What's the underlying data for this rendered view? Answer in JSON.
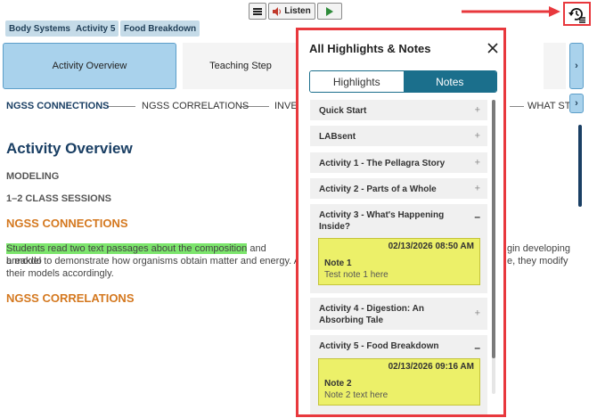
{
  "toolbar": {
    "menu_icon": "menu-icon",
    "listen_label": "Listen",
    "speaker_icon": "speaker-icon",
    "play_icon": "play-icon",
    "history_icon": "history-notes-icon"
  },
  "breadcrumbs": [
    "Body Systems",
    "Activity 5",
    "Food Breakdown"
  ],
  "tabs": {
    "active": "Activity Overview",
    "second": "Teaching Step"
  },
  "strip": {
    "items": [
      "NGSS CONNECTIONS",
      "NGSS CORRELATIONS",
      "INVE",
      "WHAT STU"
    ]
  },
  "main": {
    "title": "Activity Overview",
    "modeling": "MODELING",
    "sessions": "1–2 CLASS SESSIONS",
    "connections_heading": "NGSS CONNECTIONS",
    "para_highlight": "Students read two text passages about the composition",
    "para_rest": " and breakdo",
    "para_line2": "a model to demonstrate how organisms obtain matter and energy. A",
    "para_line3": "their models accordingly.",
    "right_line1": "gin developing",
    "right_line2": "e, they modify",
    "correlations_heading": "NGSS CORRELATIONS"
  },
  "panel": {
    "title": "All Highlights & Notes",
    "close_icon": "close-icon",
    "tab_highlights": "Highlights",
    "tab_notes": "Notes",
    "sections": [
      {
        "label": "Quick Start",
        "expanded": false
      },
      {
        "label": "LABsent",
        "expanded": false
      },
      {
        "label": "Activity 1 - The Pellagra Story",
        "expanded": false
      },
      {
        "label": "Activity 2 - Parts of a Whole",
        "expanded": false
      },
      {
        "label": "Activity 3 - What's Happening Inside?",
        "expanded": true
      },
      {
        "label": "Activity 4 - Digestion: An Absorbing Tale",
        "expanded": false
      },
      {
        "label": "Activity 5 - Food Breakdown",
        "expanded": true
      }
    ],
    "notes": [
      {
        "date": "02/13/2026 08:50 AM",
        "title": "Note 1",
        "text": "Test note 1 here"
      },
      {
        "date": "02/13/2026 09:16 AM",
        "title": "Note 2",
        "text": "Note 2 text here"
      }
    ],
    "plus": "+",
    "minus": "–"
  },
  "colors": {
    "accent": "#1b6f8c",
    "annotation_red": "#e8383d",
    "note_yellow": "#ecf069",
    "highlight_green": "#7ce56c",
    "heading_blue": "#1a3f64",
    "heading_orange": "#d4781f"
  }
}
